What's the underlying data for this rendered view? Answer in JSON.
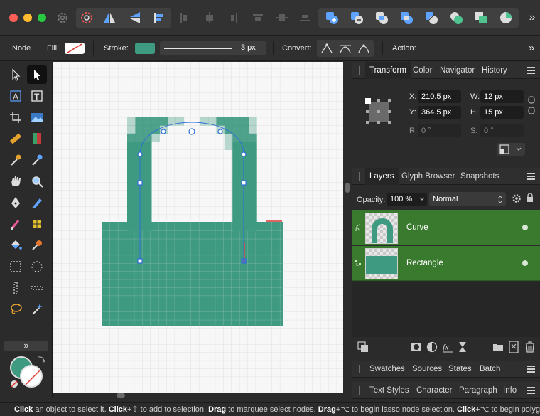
{
  "colors": {
    "teal": "#3f9a82",
    "layer_selected": "#3a7a2e",
    "accent_blue": "#2f6fd8"
  },
  "titlebar": {
    "traffic_lights": [
      "#ff5f57",
      "#febc2e",
      "#28c840"
    ],
    "overflow_glyph": "»"
  },
  "context_bar": {
    "mode_label": "Node",
    "fill_label": "Fill:",
    "stroke_label": "Stroke:",
    "stroke_width": "3 px",
    "convert_label": "Convert:",
    "action_label": "Action:",
    "overflow_glyph": "»"
  },
  "tools": {
    "expand_glyph": "»"
  },
  "transform_panel": {
    "tabs": [
      "Transform",
      "Color",
      "Navigator",
      "History"
    ],
    "x_label": "X:",
    "x_value": "210.5 px",
    "y_label": "Y:",
    "y_value": "364.5 px",
    "w_label": "W:",
    "w_value": "12 px",
    "h_label": "H:",
    "h_value": "15 px",
    "r_label": "R:",
    "r_value": "0 °",
    "s_label": "S:",
    "s_value": "0 °"
  },
  "layers_panel": {
    "tabs": [
      "Layers",
      "Glyph Browser",
      "Snapshots"
    ],
    "opacity_label": "Opacity:",
    "opacity_value": "100 %",
    "blend_mode": "Normal",
    "layers": [
      {
        "name": "Curve"
      },
      {
        "name": "Rectangle"
      }
    ]
  },
  "bottom_panels": {
    "row1": [
      "Swatches",
      "Sources",
      "States",
      "Batch"
    ],
    "row2": [
      "Text Styles",
      "Character",
      "Paragraph",
      "Info"
    ]
  },
  "status": {
    "b1": "Click",
    "t1": " an object to select it. ",
    "b2": "Click",
    "t2": "+⇧ to add to selection. ",
    "b3": "Drag",
    "t3": " to marquee select nodes. ",
    "b4": "Drag",
    "t4": "+⌥ to begin lasso node selection. ",
    "b5": "Click",
    "t5": "+⌥ to begin polygo"
  }
}
